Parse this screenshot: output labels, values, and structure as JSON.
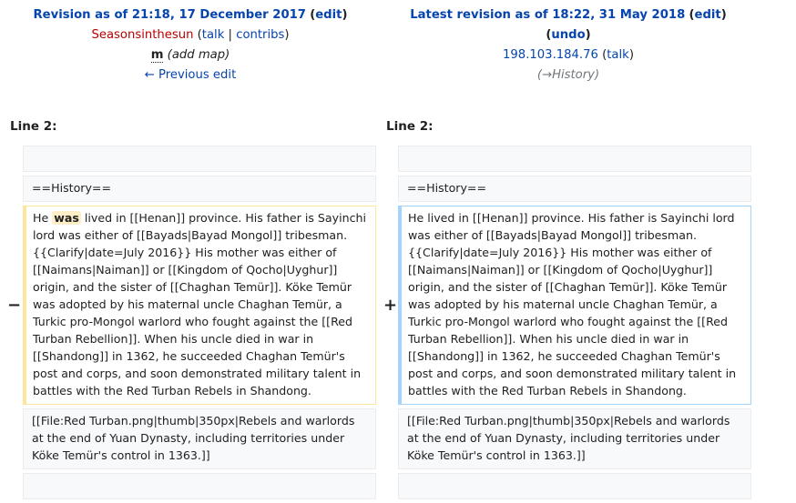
{
  "left": {
    "title": "Revision as of 21:18, 17 December 2017",
    "edit": "edit",
    "user": "Seasonsinthesun",
    "talk": "talk",
    "contribs": "contribs",
    "minor": "m",
    "summary": "(add map)",
    "prev": "← Previous edit",
    "line": "Line 2:",
    "marker": "−"
  },
  "right": {
    "title": "Latest revision as of 18:22, 31 May 2018",
    "edit": "edit",
    "undo": "undo",
    "user": "198.103.184.76",
    "talk": "talk",
    "summary_arrow": "→History",
    "line": "Line 2:",
    "marker": "+"
  },
  "context": {
    "history": "==History==",
    "file": "[[File:Red Turban.png|thumb|350px|Rebels and warlords at the end of Yuan Dynasty, including territories under Köke Temür's control in 1363.]]"
  },
  "diff": {
    "del_pre": "He ",
    "del_word": "was",
    "del_post": " lived in [[Henan]] province. His father is Sayinchi lord was either of [[Bayads|Bayad Mongol]] tribesman. {{Clarify|date=July 2016}} His mother was either of [[Naimans|Naiman]] or [[Kingdom of Qocho|Uyghur]] origin, and the sister of [[Chaghan Temür]]. Köke Temür was adopted by his maternal uncle Chaghan Temür, a Turkic pro-Mongol warlord who fought against the [[Red Turban Rebellion]]. When his uncle died in war in [[Shandong]] in 1362, he succeeded Chaghan Temür's post and corps, and soon demonstrated military talent in battles with the Red Turban Rebels in Shandong.",
    "add_text": "He lived in [[Henan]] province. His father is Sayinchi lord was either of [[Bayads|Bayad Mongol]] tribesman. {{Clarify|date=July 2016}} His mother was either of [[Naimans|Naiman]] or [[Kingdom of Qocho|Uyghur]] origin, and the sister of [[Chaghan Temür]]. Köke Temür was adopted by his maternal uncle Chaghan Temür, a Turkic pro-Mongol warlord who fought against the [[Red Turban Rebellion]]. When his uncle died in war in [[Shandong]] in 1362, he succeeded Chaghan Temür's post and corps, and soon demonstrated military talent in battles with the Red Turban Rebels in Shandong."
  }
}
